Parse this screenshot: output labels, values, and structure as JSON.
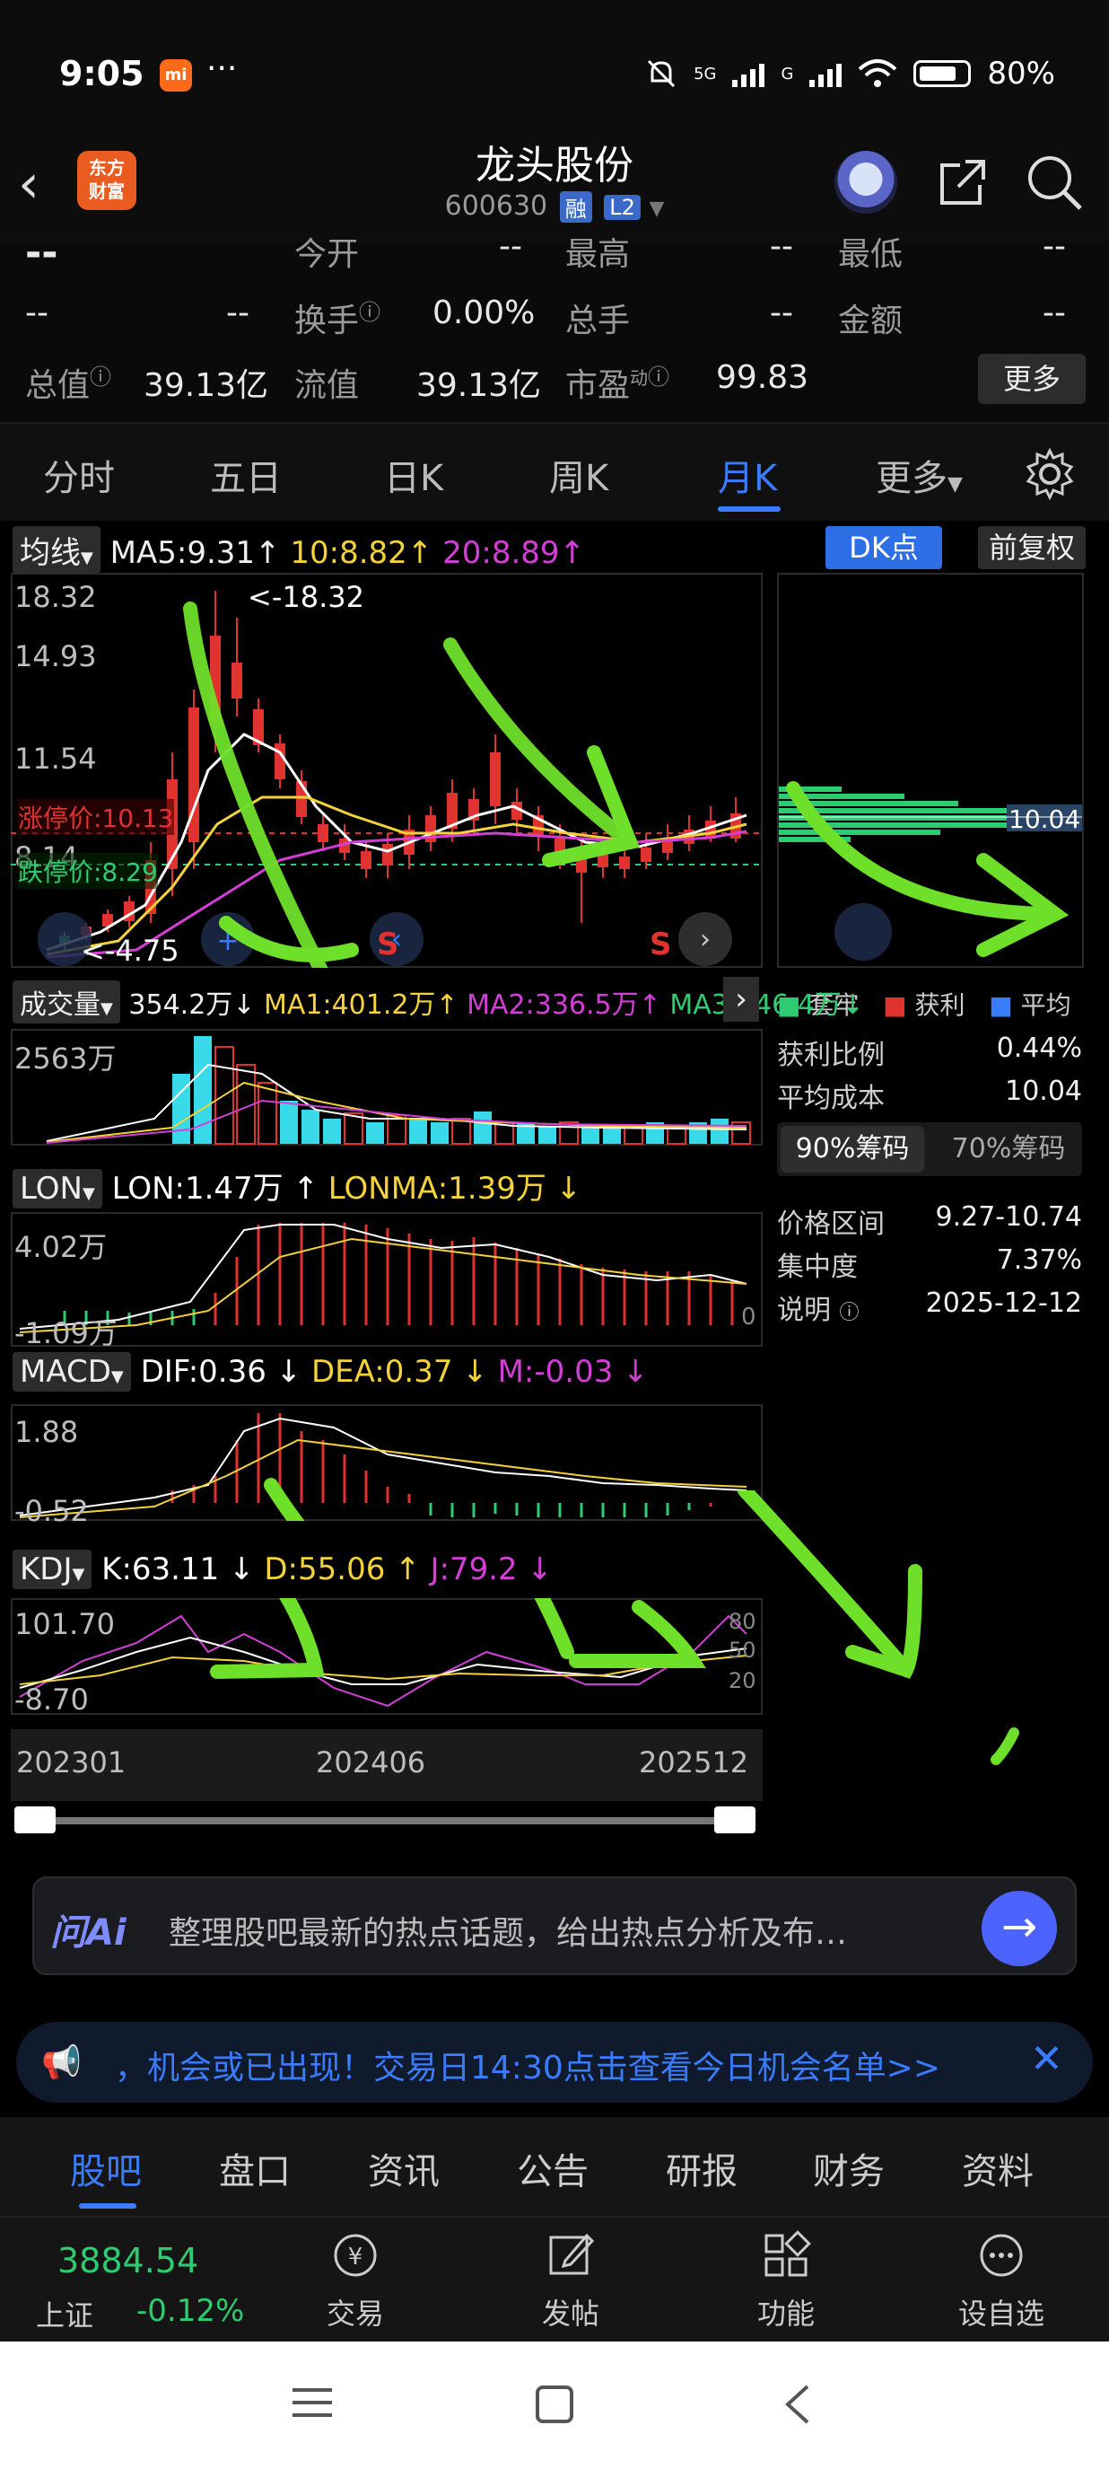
{
  "status_bar": {
    "time": "9:05",
    "mi_badge": "mi",
    "dots": "···",
    "net": "5G",
    "net2": "G",
    "battery": "80%"
  },
  "header": {
    "logo_line1": "东方",
    "logo_line2": "财富",
    "name": "龙头股份",
    "code": "600630",
    "tag_rong": "融",
    "tag_l2": "L2"
  },
  "info": {
    "price_placeholder": "--",
    "today_open_label": "今开",
    "today_open_value": "--",
    "high_label": "最高",
    "high_value": "--",
    "low_label": "最低",
    "low_value": "--",
    "change1": "--",
    "change2": "--",
    "turnover_label": "换手",
    "turnover_value": "0.00%",
    "volume_label": "总手",
    "volume_value": "--",
    "amount_label": "金额",
    "amount_value": "--",
    "mktcap_label": "总值",
    "mktcap_value": "39.13亿",
    "float_label": "流值",
    "float_value": "39.13亿",
    "pe_label": "市盈",
    "pe_sup": "动",
    "pe_value": "99.83",
    "more_label": "更多"
  },
  "tabs": [
    "分时",
    "五日",
    "日K",
    "周K",
    "月K",
    "更多"
  ],
  "active_tab": "月K",
  "main_chart": {
    "ma_button": "均线",
    "ma5": "MA5:9.31",
    "ma10": "10:8.82",
    "ma20": "20:8.89",
    "dk_button": "DK点",
    "adjust_button": "前复权",
    "y_top": "18.32",
    "y_2": "14.93",
    "y_3": "11.54",
    "y_4": "8.14",
    "max_label": "<-18.32",
    "min_label": "<-4.75",
    "limit_up": "涨停价:10.13",
    "limit_down": "跌停价:8.29",
    "s_marker": "S"
  },
  "chip": {
    "price_tag": "10.04",
    "legend_trapped": "套牢",
    "legend_profit": "获利",
    "legend_avg": "平均",
    "profit_ratio_label": "获利比例",
    "profit_ratio_value": "0.44%",
    "avg_cost_label": "平均成本",
    "avg_cost_value": "10.04",
    "chip90": "90%筹码",
    "chip70": "70%筹码",
    "range_label": "价格区间",
    "range_value": "9.27-10.74",
    "concentration_label": "集中度",
    "concentration_value": "7.37%",
    "note_label": "说明",
    "note_value": "2025-12-12"
  },
  "volume": {
    "button": "成交量",
    "val": "354.2万↓",
    "ma1": "MA1:401.2万↑",
    "ma2": "MA2:336.5万↑",
    "ma3": "MA3:446.4万↓",
    "y_top": "2563万"
  },
  "lon": {
    "button": "LON",
    "val": "LON:1.47万 ↑",
    "lonma": "LONMA:1.39万 ↓",
    "y_top": "4.02万",
    "y_bottom": "-1.09万",
    "zero": "0"
  },
  "macd": {
    "button": "MACD",
    "dif": "DIF:0.36 ↓",
    "dea": "DEA:0.37 ↓",
    "m": "M:-0.03 ↓",
    "y_top": "1.88",
    "y_bottom": "-0.52"
  },
  "kdj": {
    "button": "KDJ",
    "k": "K:63.11 ↓",
    "d": "D:55.06 ↑",
    "j": "J:79.2 ↓",
    "y_top": "101.70",
    "y_bottom": "-8.70",
    "r80": "80",
    "r50": "50",
    "r20": "20"
  },
  "x_axis": [
    "202301",
    "202406",
    "202512"
  ],
  "ai_bar": {
    "logo": "问Ai",
    "text": "整理股吧最新的热点话题，给出热点分析及布…"
  },
  "notice": {
    "text": "，机会或已出现！交易日14:30点击查看今日机会名单>>"
  },
  "bottom_tabs": [
    "股吧",
    "盘口",
    "资讯",
    "公告",
    "研报",
    "财务",
    "资料"
  ],
  "toolbar": {
    "index_value": "3884.54",
    "index_name": "上证",
    "index_change": "-0.12%",
    "trade": "交易",
    "post": "发帖",
    "func": "功能",
    "watch": "设自选"
  },
  "colors": {
    "accent": "#3b7cff",
    "up": "#e0332f",
    "down": "#2ecc71",
    "green_annot": "#6ee02a"
  }
}
